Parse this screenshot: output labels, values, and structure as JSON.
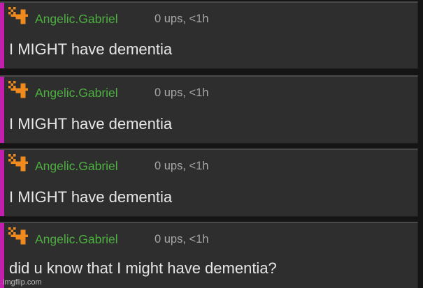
{
  "colors": {
    "accent_bar": "#c31fae",
    "username": "#4caf3f",
    "avatar": "#f08a1c",
    "background": "#2e2e2e"
  },
  "comments": [
    {
      "avatar_icon": "pixel-cross-icon",
      "username": "Angelic.Gabriel",
      "meta": "0 ups, <1h",
      "text": "I MIGHT have dementia"
    },
    {
      "avatar_icon": "pixel-cross-icon",
      "username": "Angelic.Gabriel",
      "meta": "0 ups, <1h",
      "text": "I MIGHT have dementia"
    },
    {
      "avatar_icon": "pixel-cross-icon",
      "username": "Angelic.Gabriel",
      "meta": "0 ups, <1h",
      "text": "I MIGHT have dementia"
    },
    {
      "avatar_icon": "pixel-cross-icon",
      "username": "Angelic.Gabriel",
      "meta": "0 ups, <1h",
      "text": "did u know that I might have dementia?"
    }
  ],
  "watermark": "imgflip.com"
}
